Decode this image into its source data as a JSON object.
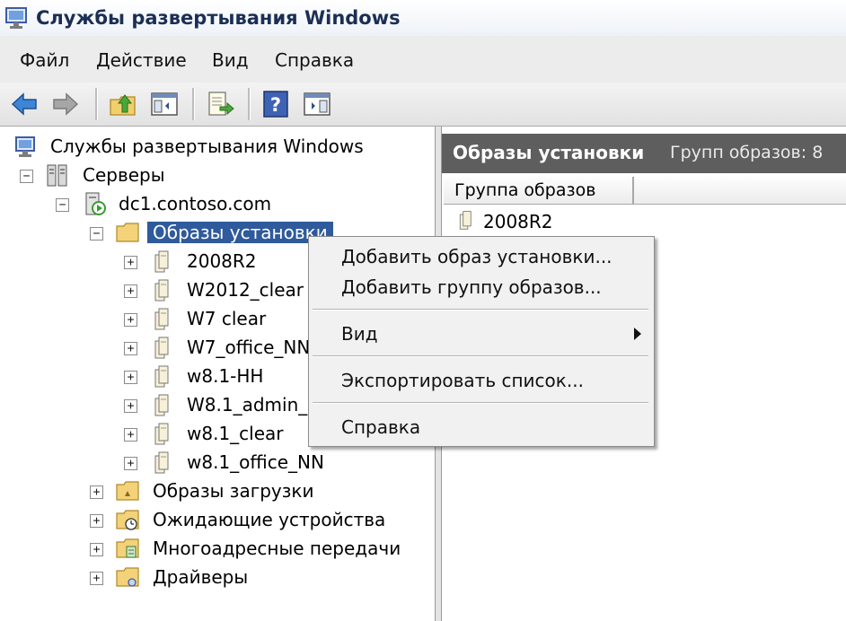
{
  "window": {
    "title": "Службы развертывания Windows"
  },
  "menubar": {
    "items": [
      "Файл",
      "Действие",
      "Вид",
      "Справка"
    ]
  },
  "toolbar": {
    "icons": [
      "back-arrow-icon",
      "forward-arrow-icon",
      "up-folder-icon",
      "show-hide-console-tree-icon",
      "export-list-icon",
      "help-icon",
      "show-hide-action-pane-icon"
    ]
  },
  "tree": {
    "root": "Службы развертывания Windows",
    "servers": "Серверы",
    "server": "dc1.contoso.com",
    "install_images": "Образы установки",
    "groups": [
      "2008R2",
      "W2012_clear",
      "W7 clear",
      "W7_office_NN",
      "w8.1-HH",
      "W8.1_admin_",
      "w8.1_clear",
      "w8.1_office_NN"
    ],
    "boot_images": "Образы загрузки",
    "pending_devices": "Ожидающие устройства",
    "multicast": "Многоадресные передачи",
    "drivers": "Драйверы"
  },
  "right_pane": {
    "header_title": "Образы установки",
    "header_count": "Групп образов: 8",
    "column": "Группа образов",
    "rows": [
      "2008R2"
    ]
  },
  "context_menu": {
    "add_image": "Добавить образ установки...",
    "add_group": "Добавить группу образов...",
    "view": "Вид",
    "export": "Экспортировать список...",
    "help": "Справка"
  },
  "colors": {
    "selection": "#2f5a9b",
    "header_bg": "#5e5e5e",
    "folder": "#f3d27a"
  }
}
